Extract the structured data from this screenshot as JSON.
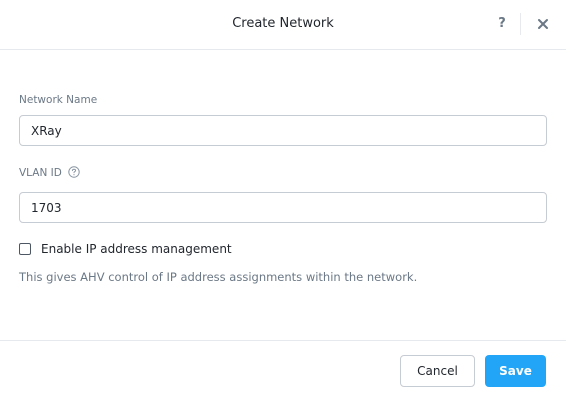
{
  "dialog": {
    "title": "Create Network",
    "help_label": "?",
    "close_icon": "close-icon"
  },
  "form": {
    "network_name": {
      "label": "Network Name",
      "value": "XRay"
    },
    "vlan_id": {
      "label": "VLAN ID",
      "value": "1703",
      "help_icon": "question-circle-icon"
    },
    "ip_management": {
      "label": "Enable IP address management",
      "checked": false,
      "description": "This gives AHV control of IP address assignments within the network."
    }
  },
  "footer": {
    "cancel_label": "Cancel",
    "save_label": "Save"
  },
  "colors": {
    "primary": "#22a5f7",
    "text": "#22272e",
    "muted": "#6b7886",
    "border": "#c6ccd3"
  }
}
